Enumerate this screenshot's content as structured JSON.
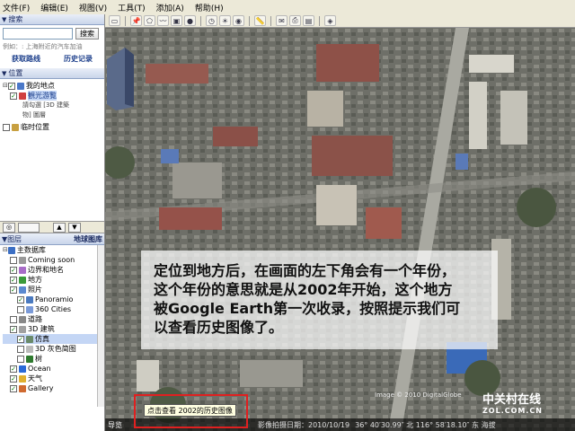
{
  "menu": [
    "文件(F)",
    "编辑(E)",
    "视图(V)",
    "工具(T)",
    "添加(A)",
    "帮助(H)"
  ],
  "search": {
    "header": "搜索",
    "button": "搜索",
    "hint": "例如：: 上海附近的汽车加油",
    "link_directions": "获取路线",
    "link_history": "历史记录"
  },
  "places": {
    "header": "位置",
    "my_places": "我的地点",
    "tour": "観光游覧",
    "tour_desc1": "請勾選 [3D 建築",
    "tour_desc2": "物] 圖層",
    "temp_places": "临时位置"
  },
  "layers": {
    "header": "图层",
    "gallery": "地球图库",
    "items": [
      {
        "label": "主数据库",
        "check": "✓",
        "icon": "globe"
      },
      {
        "label": "Coming soon",
        "check": "",
        "icon": "doc"
      },
      {
        "label": "边界和地名",
        "check": "✓",
        "icon": "border"
      },
      {
        "label": "地方",
        "check": "✓",
        "icon": "place"
      },
      {
        "label": "照片",
        "check": "✓",
        "icon": "photo"
      },
      {
        "label": "Panoramio",
        "check": "✓",
        "icon": "photo"
      },
      {
        "label": "360 Cities",
        "check": "",
        "icon": "photo"
      },
      {
        "label": "道路",
        "check": "",
        "icon": "road"
      },
      {
        "label": "3D 建筑",
        "check": "✓",
        "icon": "building"
      },
      {
        "label": "仿真",
        "check": "✓",
        "icon": "building"
      },
      {
        "label": "3D 灰色简图",
        "check": "",
        "icon": "building"
      },
      {
        "label": "树",
        "check": "",
        "icon": "tree"
      },
      {
        "label": "Ocean",
        "check": "✓",
        "icon": "ocean"
      },
      {
        "label": "天气",
        "check": "✓",
        "icon": "weather"
      },
      {
        "label": "Gallery",
        "check": "✓",
        "icon": "gallery"
      }
    ]
  },
  "caption": {
    "line1": "定位到地方后，在画面的左下角会有一个年份，",
    "line2": "这个年份的意思就是从2002年开始，这个地方",
    "line3": "被Google Earth第一次收录，按照提示我们可",
    "line4": "以查看历史图像了。"
  },
  "tooltip": "点击查看 2002的历史图像",
  "image_credit": "Image © 2010 DigitalGlobe",
  "status": {
    "nav": "导览",
    "date": "影像拍摄日期：2010/10/19",
    "coords": "36° 40′30.99″ 北 116° 58′18.10″ 东 海拔"
  },
  "watermark": {
    "cn": "中关村在线",
    "en": "ZOL.COM.CN"
  }
}
